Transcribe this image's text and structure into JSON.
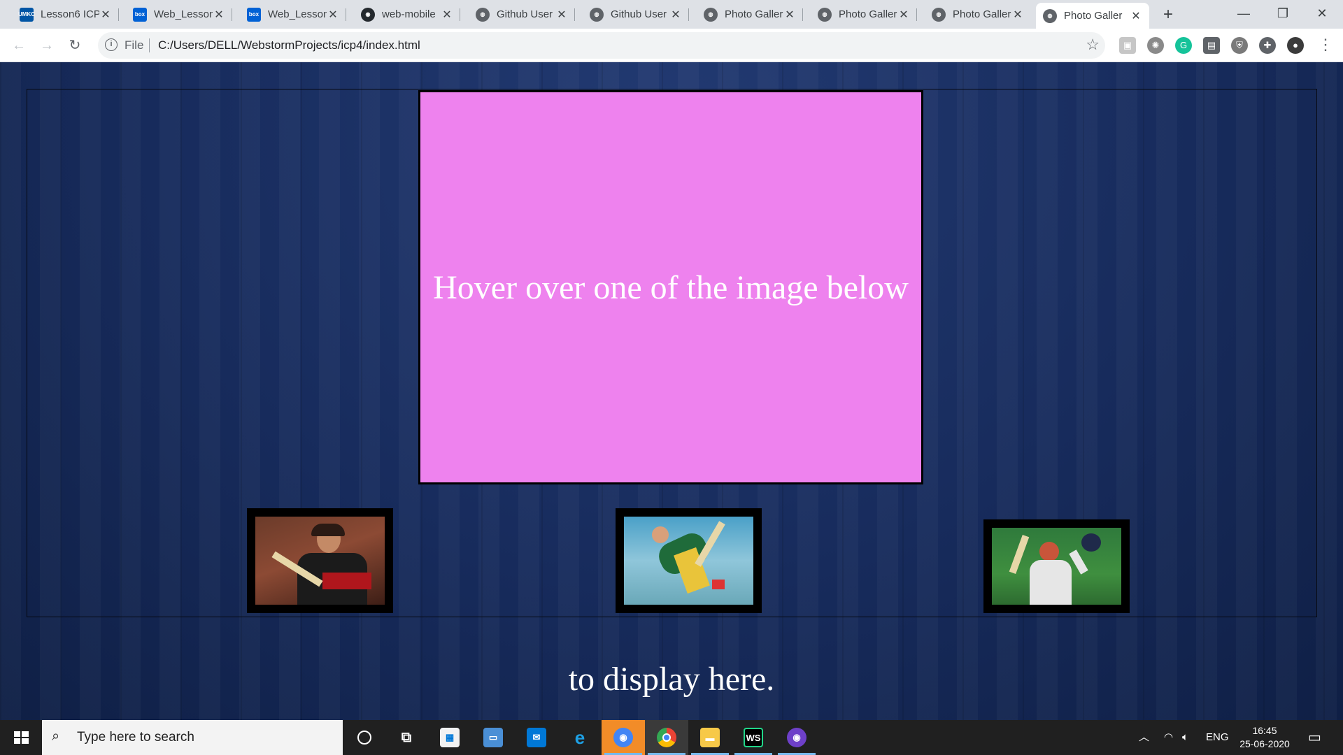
{
  "browser": {
    "tabs": [
      {
        "title": "Lesson6 ICP",
        "icon": "umkc-icon",
        "color": "#0055a5",
        "active": false
      },
      {
        "title": "Web_Lesson",
        "icon": "box-icon",
        "color": "#0061d5",
        "active": false
      },
      {
        "title": "Web_Lesson",
        "icon": "box-icon",
        "color": "#0061d5",
        "active": false
      },
      {
        "title": "web-mobile",
        "icon": "github-icon",
        "color": "#24292e",
        "active": false
      },
      {
        "title": "Github User",
        "icon": "globe-icon",
        "color": "#5f6368",
        "active": false
      },
      {
        "title": "Github User",
        "icon": "globe-icon",
        "color": "#5f6368",
        "active": false
      },
      {
        "title": "Photo Galler",
        "icon": "globe-icon",
        "color": "#5f6368",
        "active": false
      },
      {
        "title": "Photo Galler",
        "icon": "globe-icon",
        "color": "#5f6368",
        "active": false
      },
      {
        "title": "Photo Galler",
        "icon": "globe-icon",
        "color": "#5f6368",
        "active": false
      },
      {
        "title": "Photo Galler",
        "icon": "globe-icon",
        "color": "#5f6368",
        "active": true
      }
    ],
    "address": {
      "scheme_label": "File",
      "url": "C:/Users/DELL/WebstormProjects/icp4/index.html"
    }
  },
  "page": {
    "preview_text": "Hover over one of the image below",
    "preview_color": "#ee82ee",
    "footer_text": "to display here.",
    "thumbnails": [
      {
        "name": "thumbnail-cricketer-1",
        "jersey": "#b0161c"
      },
      {
        "name": "thumbnail-cricketer-2",
        "jersey": "#1f6b3a"
      },
      {
        "name": "thumbnail-cricketer-3",
        "jersey": "#e6e6e6"
      }
    ]
  },
  "taskbar": {
    "search_placeholder": "Type here to search",
    "language": "ENG",
    "time": "16:45",
    "date": "25-06-2020"
  }
}
